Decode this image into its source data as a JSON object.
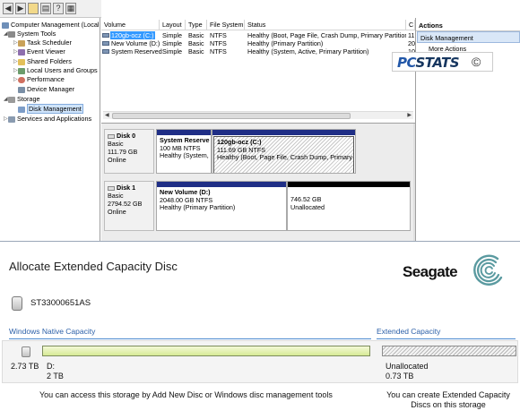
{
  "colors": {
    "primary_partition_bar": "#1f2e86",
    "unallocated_bar": "#000000",
    "selection_highlight": "#3399ff",
    "section_heading": "#2b5fa8",
    "pcstats_blue": "#2257a8"
  },
  "toolbar": {
    "icons": [
      "back-icon",
      "forward-icon",
      "folder-icon",
      "properties-icon",
      "help-icon",
      "view-icon"
    ]
  },
  "tree": {
    "root": "Computer Management (Local",
    "system_tools": "System Tools",
    "task_scheduler": "Task Scheduler",
    "event_viewer": "Event Viewer",
    "shared_folders": "Shared Folders",
    "performance": "Performance",
    "local_users": "Local Users and Groups",
    "device_manager": "Device Manager",
    "storage": "Storage",
    "disk_management": "Disk Management",
    "services": "Services and Applications"
  },
  "volume_list": {
    "headers": [
      "Volume",
      "Layout",
      "Type",
      "File System",
      "Status",
      "C"
    ],
    "rows": [
      {
        "volume": "120gb-ocz (C:)",
        "layout": "Simple",
        "type": "Basic",
        "fs": "NTFS",
        "status": "Healthy (Boot, Page File, Crash Dump, Primary Partition)",
        "cap": "11"
      },
      {
        "volume": "New Volume (D:)",
        "layout": "Simple",
        "type": "Basic",
        "fs": "NTFS",
        "status": "Healthy (Primary Partition)",
        "cap": "20"
      },
      {
        "volume": "System Reserved",
        "layout": "Simple",
        "type": "Basic",
        "fs": "NTFS",
        "status": "Healthy (System, Active, Primary Partition)",
        "cap": "10"
      }
    ]
  },
  "actions": {
    "header": "Actions",
    "selected": "Disk Management",
    "more": "More Actions"
  },
  "watermark": {
    "pc": "PC",
    "stats": "STATS",
    "copyright": "©"
  },
  "disks": [
    {
      "name": "Disk 0",
      "type": "Basic",
      "size": "111.79 GB",
      "state": "Online",
      "partitions": [
        {
          "name": "System Reserve",
          "size": "100 MB NTFS",
          "status": "Healthy (System,"
        },
        {
          "name": "120gb-ocz  (C:)",
          "size": "111.69 GB NTFS",
          "status": "Healthy (Boot, Page File, Crash Dump, Primary Pa"
        }
      ]
    },
    {
      "name": "Disk 1",
      "type": "Basic",
      "size": "2794.52 GB",
      "state": "Online",
      "partitions": [
        {
          "name": "New Volume  (D:)",
          "size": "2048.00 GB NTFS",
          "status": "Healthy (Primary Partition)"
        },
        {
          "name": "",
          "size": "746.52 GB",
          "status": "Unallocated"
        }
      ]
    }
  ],
  "seagate": {
    "title": "Allocate Extended Capacity Disc",
    "brand": "Seagate",
    "disk_name": "ST33000651AS",
    "native_heading": "Windows Native Capacity",
    "extended_heading": "Extended Capacity",
    "total_capacity": "2.73 TB",
    "native_drive": "D:",
    "native_size": "2 TB",
    "unallocated_label": "Unallocated",
    "unallocated_size": "0.73 TB",
    "native_note": "You can access this storage by Add New Disc or Windows disc management tools",
    "extended_note": "You can create Extended Capacity Discs on this storage"
  }
}
